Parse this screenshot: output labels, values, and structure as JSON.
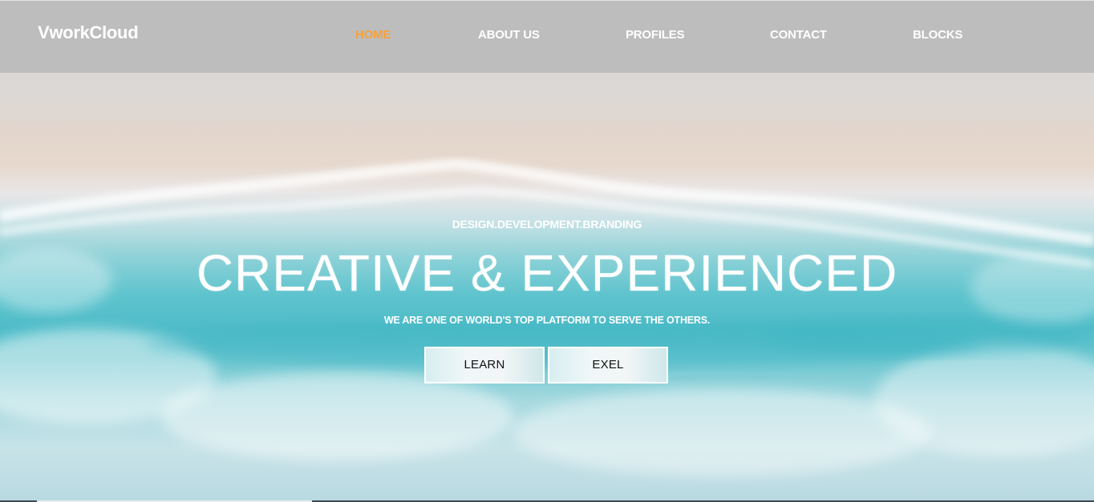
{
  "brand": {
    "name": "VworkCloud"
  },
  "nav": {
    "items": [
      {
        "label": "HOME",
        "active": true
      },
      {
        "label": "ABOUT US",
        "active": false
      },
      {
        "label": "PROFILES",
        "active": false
      },
      {
        "label": "CONTACT",
        "active": false
      },
      {
        "label": "BLOCKS",
        "active": false
      }
    ]
  },
  "hero": {
    "tagline": "DESIGN.DEVELOPMENT.BRANDING",
    "headline": "CREATIVE & EXPERIENCED",
    "subline": "WE ARE ONE OF WORLD'S TOP PLATFORM TO SERVE THE OTHERS.",
    "buttons": {
      "learn": "LEARN",
      "exel": "EXEL"
    }
  },
  "colors": {
    "navbar_bg": "#bcbcbc",
    "nav_text": "#ffffff",
    "nav_active": "#f7a23a",
    "hero_sea": "#4fbcc8",
    "hero_sand": "#e6d8cd"
  }
}
